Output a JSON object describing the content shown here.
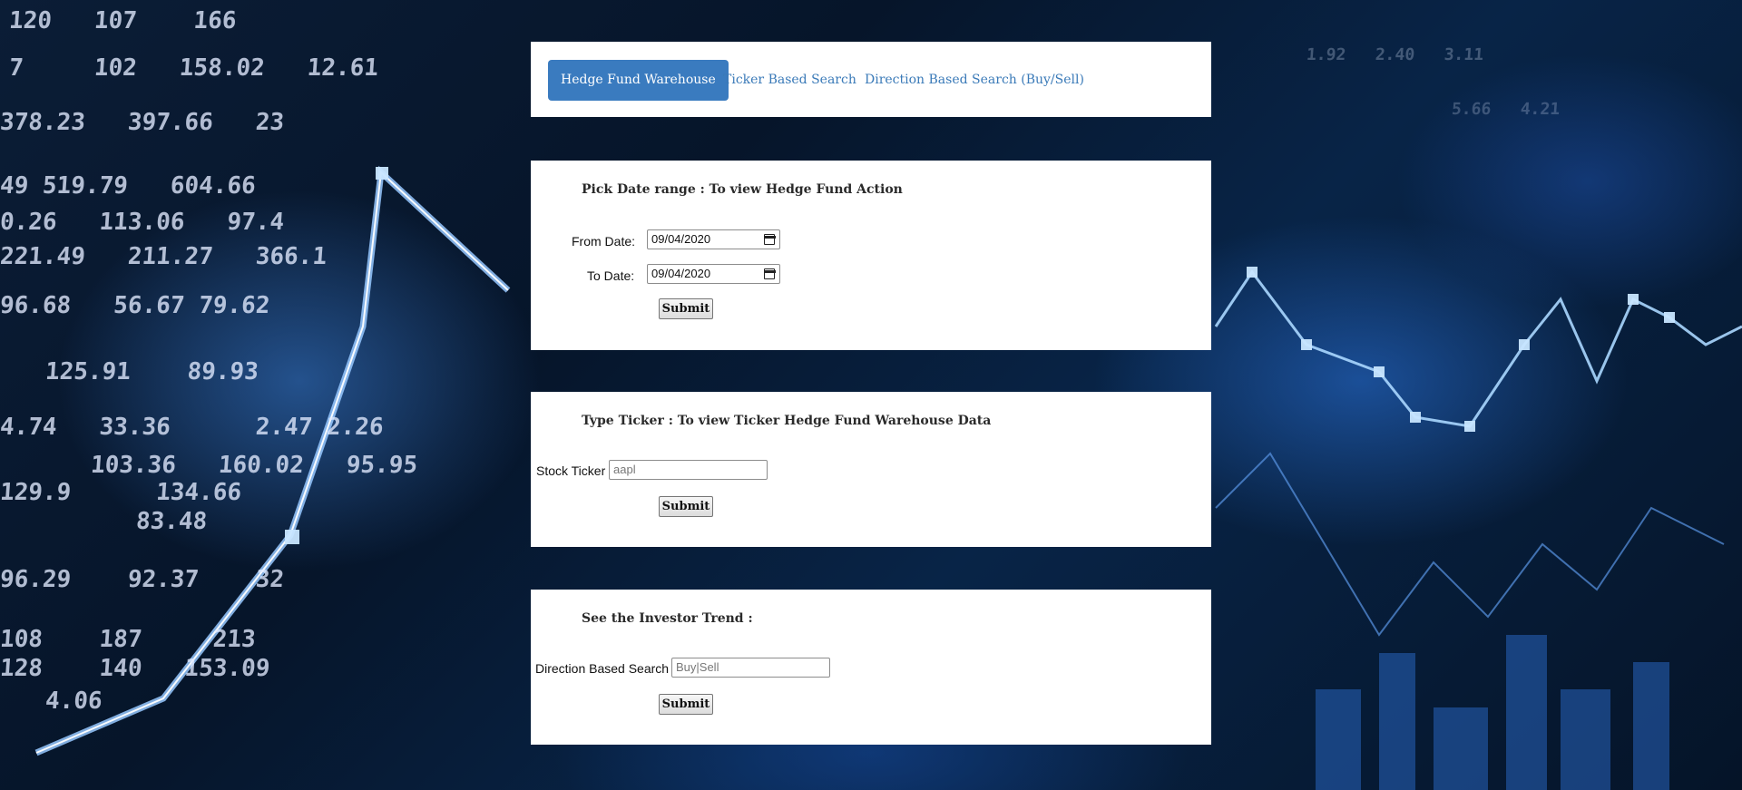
{
  "nav": {
    "tabs": [
      {
        "label": "Hedge Fund Warehouse",
        "active": true
      },
      {
        "label": "Ticker Based Search",
        "active": false
      },
      {
        "label": "Direction Based Search (Buy/Sell)",
        "active": false
      }
    ]
  },
  "date_range": {
    "heading": "Pick Date range : To view Hedge Fund Action",
    "from_label": "From Date:",
    "from_value": "09/04/2020",
    "to_label": "To Date:",
    "to_value": "09/04/2020",
    "submit_label": "Submit"
  },
  "ticker": {
    "heading": "Type Ticker : To view Ticker Hedge Fund Warehouse Data",
    "label": "Stock Ticker",
    "placeholder": "aapl",
    "submit_label": "Submit"
  },
  "direction": {
    "heading": "See the Investor Trend :",
    "label": "Direction Based Search",
    "placeholder": "Buy|Sell",
    "submit_label": "Submit"
  },
  "colors": {
    "accent": "#3a7bbf",
    "link": "#3a7ab8",
    "panel_bg": "#ffffff"
  }
}
